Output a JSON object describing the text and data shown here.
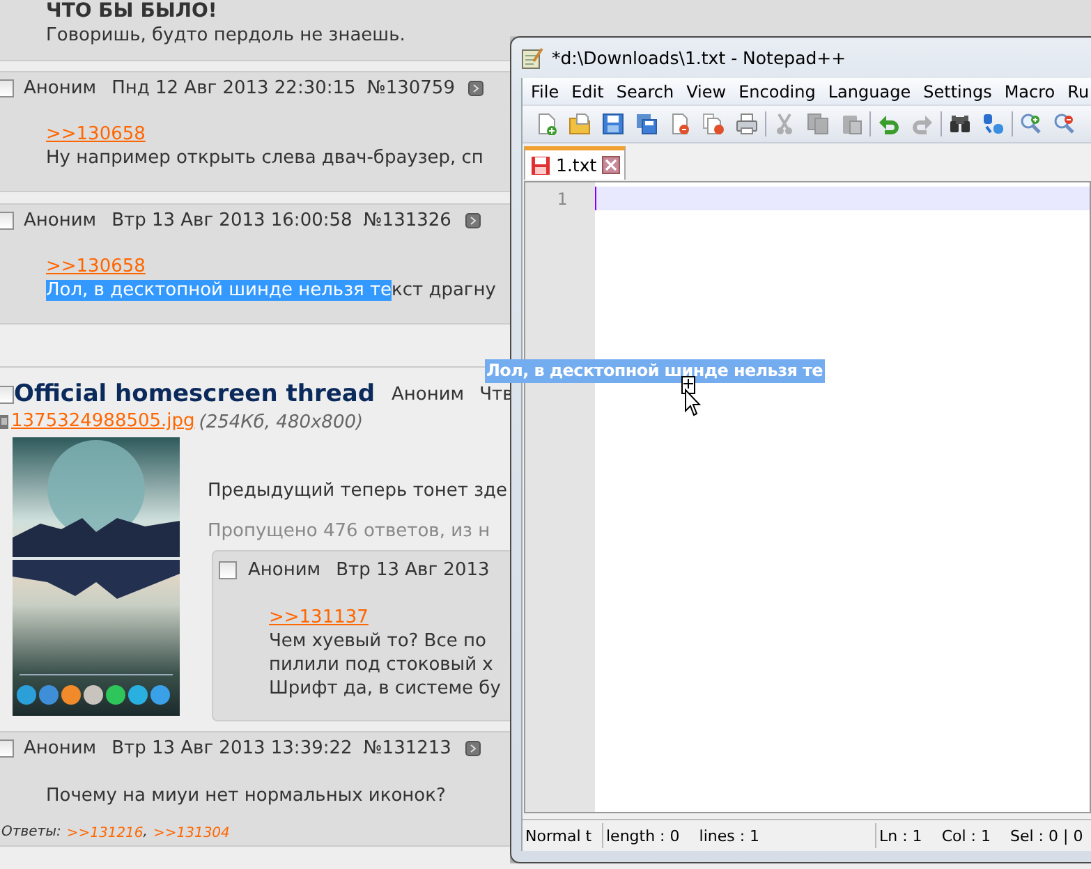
{
  "board": {
    "top_post": {
      "subject": "ЧТО БЫ БЫЛО!",
      "text": "Говоришь, будто пердоль не знаешь."
    },
    "replies": [
      {
        "checked": false,
        "author": "Аноним",
        "date": "Пнд 12 Авг 2013 22:30:15",
        "number": "№130759",
        "link": ">>130658",
        "text": "Ну например открыть слева двач-браузер, сп"
      },
      {
        "checked": false,
        "author": "Аноним",
        "date": "Втр 13 Авг 2013 16:00:58",
        "number": "№131326",
        "link": ">>130658",
        "selected_text": "Лол, в десктопной шинде нельзя те",
        "text": "кст драгну"
      }
    ],
    "thread": {
      "checked": false,
      "subject": "Official homescreen thread",
      "author": "Аноним",
      "date": "Чтв",
      "file_link": "1375324988505.jpg",
      "file_info": "(254Кб, 480x800)",
      "text": "Предыдущий теперь тонет зде",
      "omitted": "Пропущено 476 ответов, из н",
      "nested_reply": {
        "checked": false,
        "author": "Аноним",
        "date": "Втр 13 Авг 2013",
        "link": ">>131137",
        "lines": [
          "Чем хуевый то? Все по",
          "пилили под стоковый х",
          "Шрифт да, в системе бу"
        ]
      }
    },
    "last_post": {
      "checked": false,
      "author": "Аноним",
      "date": "Втр 13 Авг 2013 13:39:22",
      "number": "№131213",
      "text": "Почему на миуи нет нормальных иконок?",
      "answers_label": "Ответы:",
      "answers": [
        ">>131216",
        ">>131304"
      ],
      "answers_separator": ","
    }
  },
  "notepad": {
    "title": "*d:\\Downloads\\1.txt - Notepad++",
    "menu": [
      "File",
      "Edit",
      "Search",
      "View",
      "Encoding",
      "Language",
      "Settings",
      "Macro",
      "Ru"
    ],
    "toolbar": [
      {
        "kind": "new",
        "disabled": false
      },
      {
        "kind": "open",
        "disabled": false
      },
      {
        "kind": "save",
        "disabled": false
      },
      {
        "kind": "saveall",
        "disabled": false
      },
      {
        "kind": "close",
        "disabled": false
      },
      {
        "kind": "closeall",
        "disabled": false
      },
      {
        "kind": "print",
        "disabled": false
      },
      {
        "kind": "cut",
        "disabled": true
      },
      {
        "kind": "copy",
        "disabled": true
      },
      {
        "kind": "paste",
        "disabled": true
      },
      {
        "kind": "undo",
        "disabled": false
      },
      {
        "kind": "redo",
        "disabled": true
      },
      {
        "kind": "find",
        "disabled": false
      },
      {
        "kind": "replace",
        "disabled": false
      },
      {
        "kind": "zoomin",
        "disabled": false
      },
      {
        "kind": "zoomout",
        "disabled": false
      }
    ],
    "tabs": [
      {
        "label": "1.txt",
        "selected": true,
        "modified": true
      }
    ],
    "line_numbers": [
      "1"
    ],
    "status": {
      "language": "Normal t",
      "length": "length : 0",
      "lines": "lines : 1",
      "ln": "Ln : 1",
      "col": "Col : 1",
      "sel": "Sel : 0 | 0"
    }
  },
  "drag": {
    "text": "Лол, в десктопной шинде нельзя те"
  }
}
